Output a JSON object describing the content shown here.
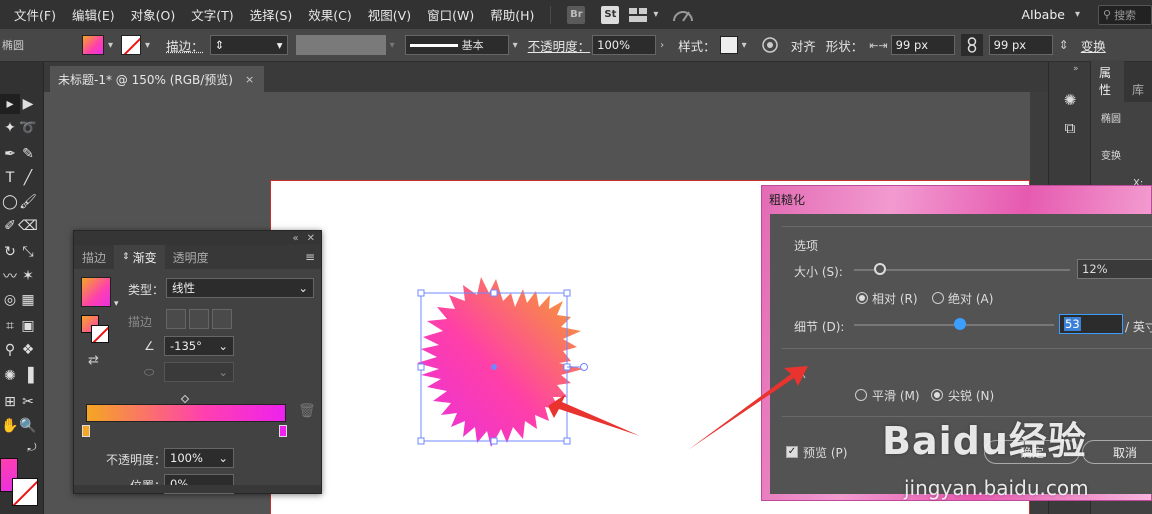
{
  "menubar": {
    "items": [
      "文件(F)",
      "编辑(E)",
      "对象(O)",
      "文字(T)",
      "选择(S)",
      "效果(C)",
      "视图(V)",
      "窗口(W)",
      "帮助(H)"
    ],
    "bridge_badge": "Br",
    "stock_badge": "St",
    "workspace": "AIbabe",
    "search_placeholder": "搜索"
  },
  "controlbar": {
    "object_label": "椭圆",
    "stroke_label": "描边：",
    "stroke_style": "基本",
    "opacity_label": "不透明度：",
    "opacity_value": "100%",
    "style_label": "样式：",
    "align_label": "对齐",
    "shape_label": "形状：",
    "width_value": "99 px",
    "height_value": "99 px",
    "transform_label": "变换"
  },
  "document": {
    "tab_title": "未标题-1* @ 150% (RGB/预览)",
    "close_glyph": "×"
  },
  "gradient_panel": {
    "tabs": [
      "描边",
      "渐变",
      "透明度"
    ],
    "type_label": "类型：",
    "type_value": "线性",
    "stroke_label": "描边",
    "angle_value": "-135°",
    "opacity_label": "不透明度：",
    "opacity_value": "100%",
    "position_label": "位置：",
    "position_value": "0%",
    "stops": [
      {
        "color": "#f5a623",
        "location": 0
      },
      {
        "color": "#ee22ee",
        "location": 1
      }
    ]
  },
  "properties_panel": {
    "tabs": [
      "属性",
      "库"
    ],
    "object_name": "椭圆",
    "section": "变换",
    "x_label": "X:"
  },
  "roughen_dialog": {
    "title": "粗糙化",
    "options_label": "选项",
    "size_label": "大小 (S):",
    "size_value": "12%",
    "size_fraction": 0.12,
    "relative_label": "相对 (R)",
    "absolute_label": "绝对 (A)",
    "detail_label": "细节 (D):",
    "detail_value": "53",
    "detail_fraction": 0.53,
    "detail_unit": "/ 英寸",
    "points_label": "点",
    "smooth_label": "平滑 (M)",
    "corner_label": "尖锐 (N)",
    "preview_label": "预览 (P)",
    "ok_label": "确定",
    "cancel_label": "取消"
  },
  "watermark": {
    "brand": "Baidu经验",
    "url": "jingyan.baidu.com"
  },
  "colors": {
    "accent_blue": "#3b82d6",
    "artboard_border": "#c8302c",
    "arrow_red": "#e8332e",
    "gradient_start": "#f5a623",
    "gradient_end": "#e830e0"
  }
}
